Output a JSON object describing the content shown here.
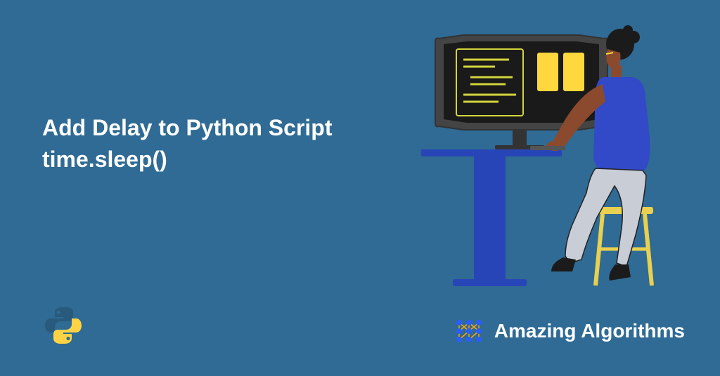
{
  "heading": {
    "line1": "Add Delay to Python Script",
    "line2": "time.sleep()"
  },
  "brand": {
    "name": "Amazing Algorithms"
  },
  "colors": {
    "background": "#2f6b94",
    "text": "#ffffff",
    "accent_blue": "#3a5fd1",
    "accent_yellow": "#ffd83d",
    "skin": "#8b4a2e",
    "hair": "#1b1b1b",
    "shirt": "#3249c8",
    "pants": "#c8cdd6",
    "monitor": "#2b2b2b",
    "screen": "#1a1a1a"
  }
}
